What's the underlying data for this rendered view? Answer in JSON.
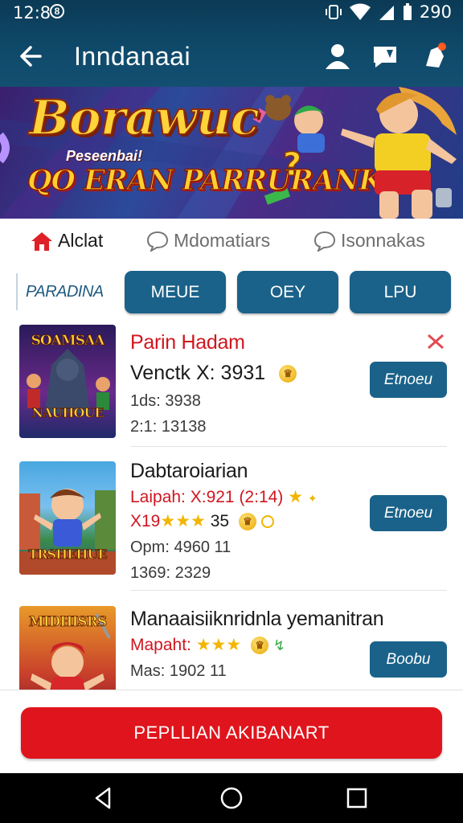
{
  "status_bar": {
    "time": "12:8",
    "notif_icon": "notification-icon",
    "battery_text": "290",
    "icons": [
      "vibrate-icon",
      "wifi-icon",
      "signal-icon",
      "battery-icon"
    ]
  },
  "app_bar": {
    "title": "Inndanaai",
    "actions": [
      "profile-icon",
      "message-icon",
      "notification-bell-icon"
    ]
  },
  "banner": {
    "title": "Borawuc",
    "small_text": "Peseenbai!",
    "subtitle": "QO ERAN PARRURANKA!"
  },
  "tabs": [
    {
      "label": "Alclat",
      "icon": "home-icon",
      "active": true
    },
    {
      "label": "Mdomatiars",
      "icon": "chat-icon",
      "active": false
    },
    {
      "label": "Isonnakas",
      "icon": "chat-icon",
      "active": false
    }
  ],
  "categories": {
    "label": "PARADINA",
    "buttons": [
      "MEUE",
      "OEY",
      "LPU"
    ]
  },
  "items": [
    {
      "thumb_top": "SOAMSAA",
      "thumb_bottom": "NAUHOUE",
      "title": "Parin Hadam",
      "line2": "Venctk X: 3931",
      "line3": "1ds: 3938",
      "line4": "2:1: 13138",
      "button": "Etnoeu"
    },
    {
      "thumb_top": "",
      "thumb_bottom": "TRSHEHUE",
      "title": "Dabtaroiarian",
      "line2": "Laipah: X:921 (2:14)",
      "line3": "X19",
      "line3_suffix": "35",
      "line4": "Opm: 4960  11",
      "line5": "1369: 2329",
      "button": "Etnoeu"
    },
    {
      "thumb_top": "MIDHISRS",
      "thumb_bottom": "",
      "title": "Manaaisiiknridnla yemanitran",
      "line2": "Mapaht:",
      "line3": "Mas: 1902  11",
      "button": "Boobu"
    }
  ],
  "cta": {
    "label": "PEPLLIAN AKIBANART"
  },
  "nav": [
    "back-nav-icon",
    "home-nav-icon",
    "recents-nav-icon"
  ]
}
